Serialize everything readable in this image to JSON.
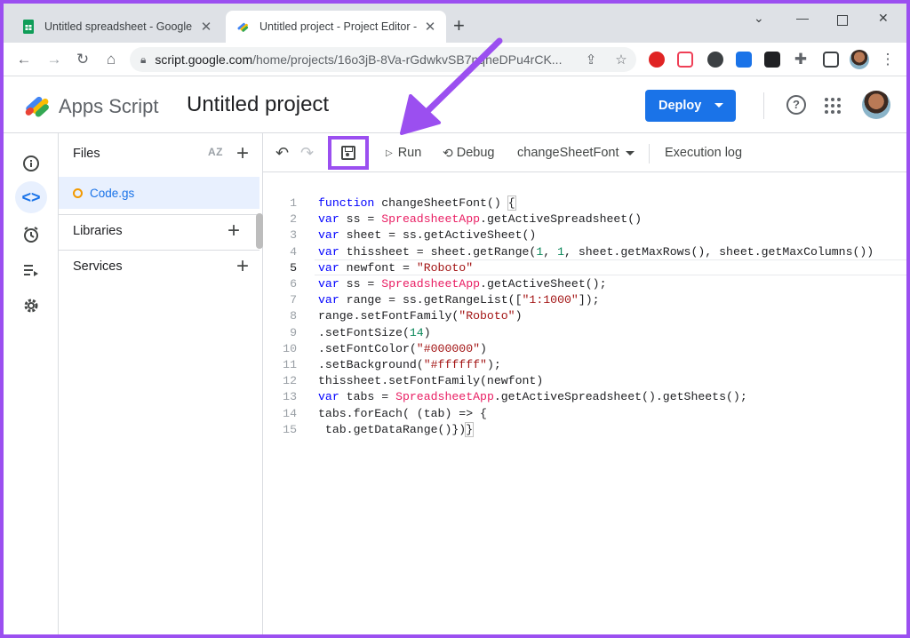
{
  "browser": {
    "tabs": [
      {
        "title": "Untitled spreadsheet - Google Sh",
        "active": false
      },
      {
        "title": "Untitled project - Project Editor -",
        "active": true
      }
    ],
    "url_host": "script.google.com",
    "url_path": "/home/projects/16o3jB-8Va-rGdwkvSB7nqheDPu4rCK..."
  },
  "header": {
    "product": "Apps Script",
    "project_title": "Untitled project",
    "deploy_label": "Deploy"
  },
  "files_panel": {
    "files_label": "Files",
    "sort_label": "AZ",
    "file": "Code.gs",
    "libraries_label": "Libraries",
    "services_label": "Services"
  },
  "editor_toolbar": {
    "run_label": "Run",
    "debug_label": "Debug",
    "function_select": "changeSheetFont",
    "execution_log_label": "Execution log"
  },
  "code": {
    "current_line": 5,
    "lines": [
      "function changeSheetFont() {",
      "var ss = SpreadsheetApp.getActiveSpreadsheet()",
      "var sheet = ss.getActiveSheet()",
      "var thissheet = sheet.getRange(1, 1, sheet.getMaxRows(), sheet.getMaxColumns())",
      "var newfont = \"Roboto\"",
      "var ss = SpreadsheetApp.getActiveSheet();",
      "var range = ss.getRangeList([\"1:1000\"]);",
      "range.setFontFamily(\"Roboto\")",
      ".setFontSize(14)",
      ".setFontColor(\"#000000\")",
      ".setBackground(\"#ffffff\");",
      "thissheet.setFontFamily(newfont)",
      "var tabs = SpreadsheetApp.getActiveSpreadsheet().getSheets();",
      "tabs.forEach( (tab) => {",
      " tab.getDataRange()})}"
    ]
  },
  "colors": {
    "annotation": "#9b4ff0",
    "deploy_button": "#1a73e8",
    "active_file_bg": "#e8f0fe"
  }
}
